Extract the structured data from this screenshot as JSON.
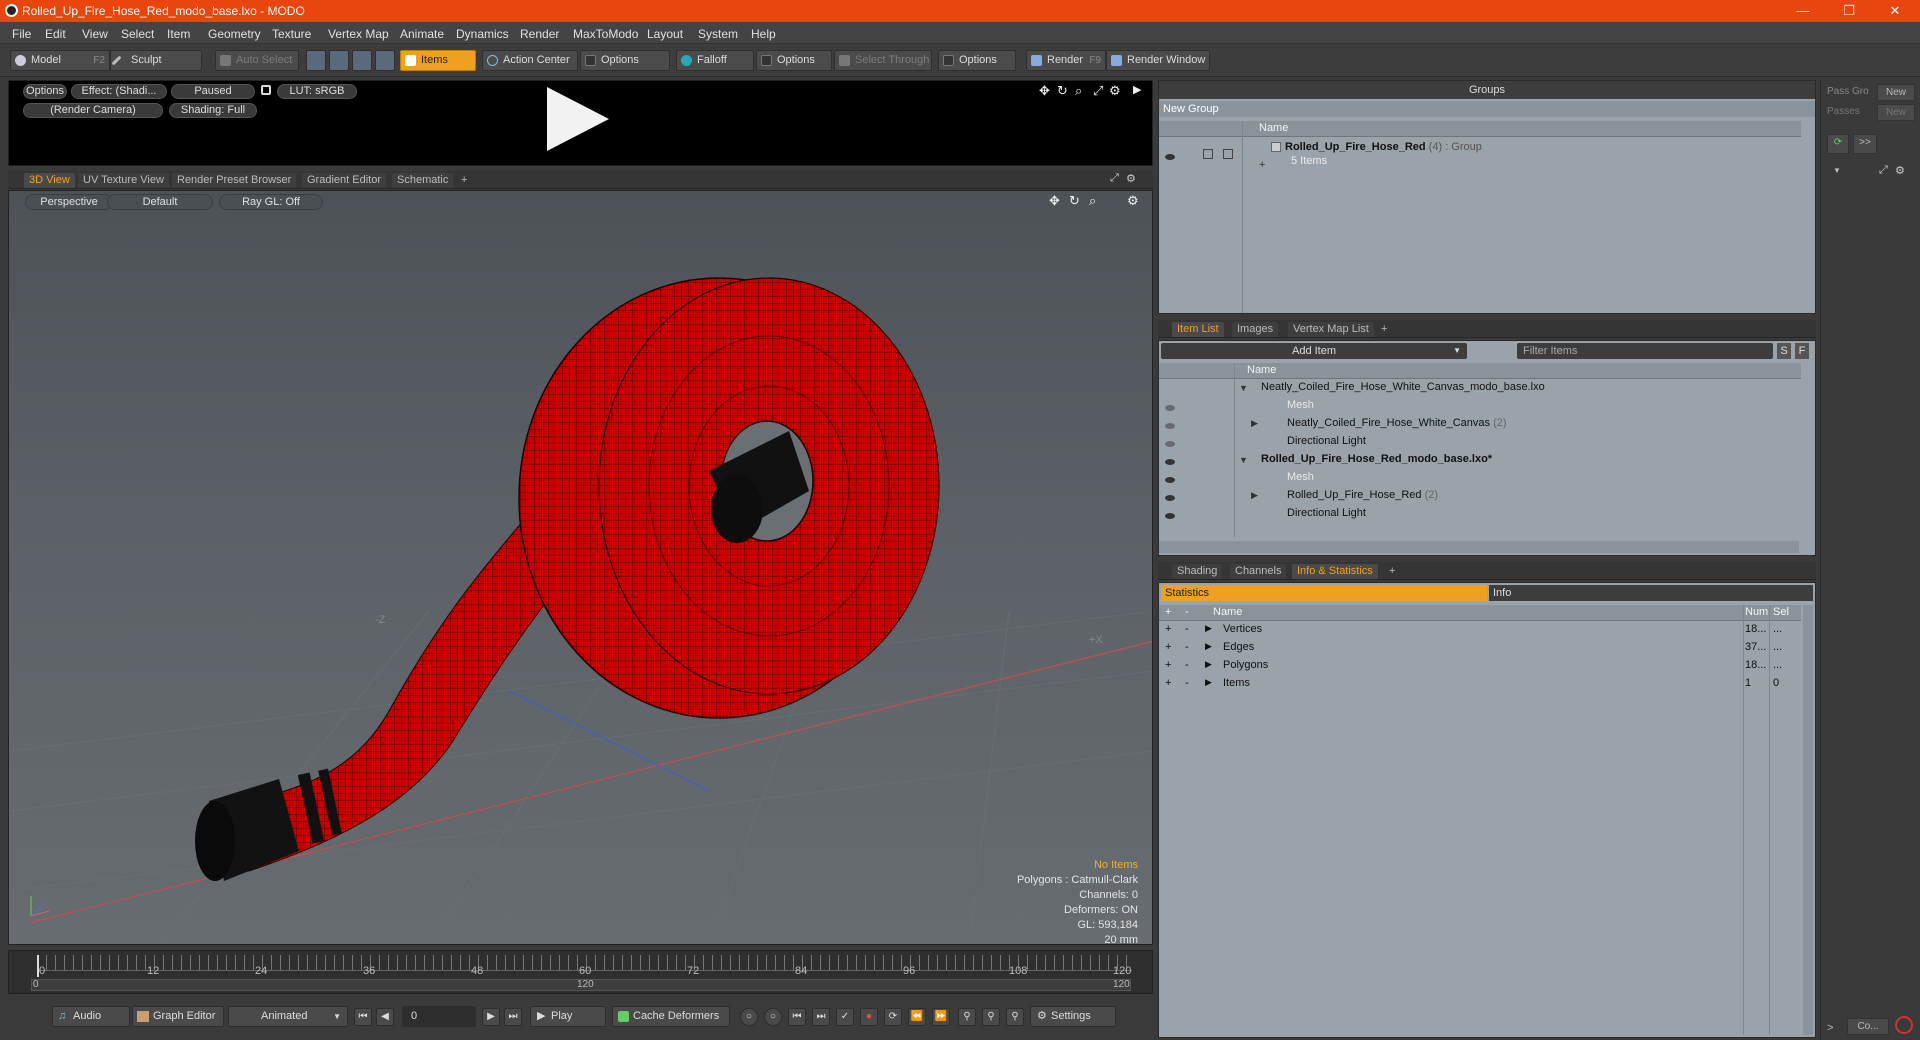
{
  "window": {
    "title": "Rolled_Up_Fire_Hose_Red_modo_base.lxo - MODO",
    "minimize": "—",
    "maximize": "❐",
    "close": "✕"
  },
  "menu": [
    "File",
    "Edit",
    "View",
    "Select",
    "Item",
    "Geometry",
    "Texture",
    "Vertex Map",
    "Animate",
    "Dynamics",
    "Render",
    "MaxToModo",
    "Layout",
    "System",
    "Help"
  ],
  "toolbar": {
    "model": "Model",
    "model_key": "F2",
    "sculpt": "Sculpt",
    "auto_select": "Auto Select",
    "items": "Items",
    "action_center": "Action Center",
    "options1": "Options",
    "falloff": "Falloff",
    "options2": "Options",
    "select_through": "Select Through",
    "options3": "Options",
    "render": "Render",
    "render_key": "F9",
    "render_window": "Render Window"
  },
  "preview": {
    "options": "Options",
    "effect": "Effect: (Shadi...",
    "paused": "Paused",
    "lut": "LUT: sRGB",
    "camera": "(Render Camera)",
    "shading": "Shading: Full"
  },
  "view_tabs": [
    "3D View",
    "UV Texture View",
    "Render Preset Browser",
    "Gradient Editor",
    "Schematic",
    "+"
  ],
  "viewport": {
    "perspective": "Perspective",
    "default": "Default",
    "raygl": "Ray GL: Off",
    "axis_z": "-Z",
    "axis_x": "+X",
    "info": {
      "no_items": "No Items",
      "polygons": "Polygons : Catmull-Clark",
      "channels": "Channels: 0",
      "deformers": "Deformers: ON",
      "gl": "GL: 593,184",
      "scale": "20 mm"
    }
  },
  "timeline": {
    "ticks": [
      "0",
      "12",
      "24",
      "36",
      "48",
      "60",
      "72",
      "84",
      "96",
      "108",
      "120"
    ],
    "sub_start": "0",
    "sub_mid": "120",
    "sub_end": "120"
  },
  "transport": {
    "audio": "Audio",
    "graph_editor": "Graph Editor",
    "animated": "Animated",
    "frame": "0",
    "play": "Play",
    "cache": "Cache Deformers",
    "settings": "Settings"
  },
  "groups": {
    "title": "Groups",
    "new_group": "New Group",
    "col_name": "Name",
    "item_name": "Rolled_Up_Fire_Hose_Red",
    "item_count": "(4)",
    "item_type": ": Group",
    "item_sub": "5 Items"
  },
  "sidebar": {
    "pass_group": "Pass Gro",
    "new1": "New",
    "passes": "Passes",
    "new2": "New",
    "more": ">>",
    "co": "Co..."
  },
  "item_list": {
    "tabs": [
      "Item List",
      "Images",
      "Vertex Map List",
      "+"
    ],
    "add_item": "Add Item",
    "filter": "Filter Items",
    "s": "S",
    "f": "F",
    "col_name": "Name",
    "rows": [
      {
        "label": "Neatly_Coiled_Fire_Hose_White_Canvas_modo_base.lxo",
        "count": ""
      },
      {
        "label": "Mesh",
        "count": ""
      },
      {
        "label": "Neatly_Coiled_Fire_Hose_White_Canvas",
        "count": "(2)"
      },
      {
        "label": "Directional Light",
        "count": ""
      },
      {
        "label": "Rolled_Up_Fire_Hose_Red_modo_base.lxo*",
        "count": ""
      },
      {
        "label": "Mesh",
        "count": ""
      },
      {
        "label": "Rolled_Up_Fire_Hose_Red",
        "count": "(2)"
      },
      {
        "label": "Directional Light",
        "count": ""
      }
    ]
  },
  "stats": {
    "tabs": [
      "Shading",
      "Channels",
      "Info & Statistics",
      "+"
    ],
    "statistics": "Statistics",
    "info": "Info",
    "col_name": "Name",
    "col_num": "Num",
    "col_sel": "Sel",
    "rows": [
      {
        "name": "Vertices",
        "num": "18...",
        "sel": "..."
      },
      {
        "name": "Edges",
        "num": "37...",
        "sel": "..."
      },
      {
        "name": "Polygons",
        "num": "18...",
        "sel": "..."
      },
      {
        "name": "Items",
        "num": "1",
        "sel": "0"
      }
    ]
  },
  "colors": {
    "accent": "#f0a020",
    "titlebar": "#e8460e",
    "hose": "#d00000"
  }
}
